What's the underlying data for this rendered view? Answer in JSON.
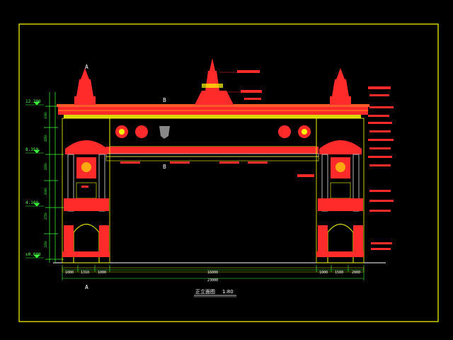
{
  "title": "正立面图",
  "scale": "1:80",
  "section_marks": {
    "top_left": "A",
    "top_mid": "B",
    "mid": "B",
    "bottom": "A"
  },
  "elevations": [
    "12.200",
    "8.350",
    "4.100",
    "±0.000"
  ],
  "dimensions": {
    "bottom_segments": [
      "1000",
      "1310",
      "1000",
      "16000",
      "1000",
      "1500",
      "2000"
    ],
    "overall": "23000"
  },
  "colors": {
    "frame": "#ffff00",
    "ornament": "#ff2a2a",
    "dimension": "#3cff3c",
    "line": "#ffffff"
  }
}
